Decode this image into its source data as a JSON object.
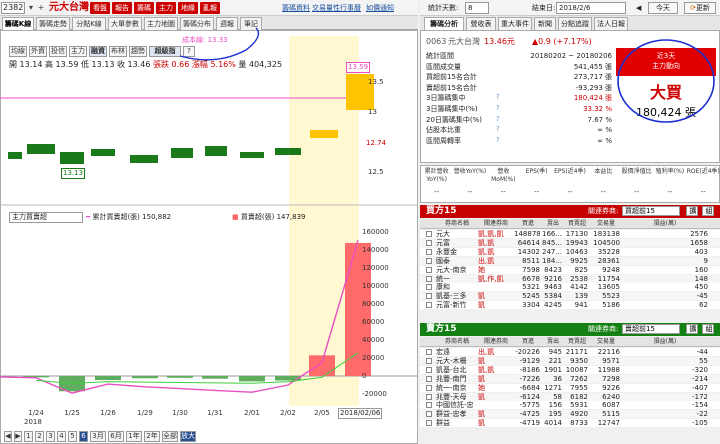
{
  "topbar": {
    "code": "2382R",
    "stock_name": "元大台灣",
    "buttons": [
      "看盤",
      "報告",
      "籌碼",
      "主力",
      "地緣",
      "亂報"
    ],
    "links": [
      "籌碼資料",
      "交易量性",
      "行事曆",
      "如價通知"
    ]
  },
  "left_tabs": [
    "籌碼K線",
    "籌碼走勢",
    "分點K線",
    "大單參數",
    "主力地圖",
    "籌碼分布",
    "週報",
    "筆記"
  ],
  "chart_tabs": [
    "均線",
    "外資",
    "投信",
    "主力",
    "融資",
    "布林",
    "趨勢",
    "超級指",
    "?"
  ],
  "cost_label": "成本線: 13.33",
  "ohlc": {
    "open_label": "開",
    "open": "13.14",
    "high_label": "高",
    "high": "13.59",
    "low_label": "低",
    "low": "13.13",
    "close_label": "收",
    "close": "13.46",
    "change": "張跌 0.66",
    "pct": "漲幅 5.16%",
    "vol_label": "量",
    "vol": "404,325"
  },
  "price_axis": [
    "13.59",
    "13.5",
    "13",
    "12.74",
    "12.5"
  ],
  "indicator": {
    "select": "主力買賣超",
    "legend1_label": "累計買賣超(張)",
    "legend1_value": "150,882",
    "legend2_label": "買賣超(張)",
    "legend2_value": "147,839"
  },
  "chart_data": [
    {
      "type": "bar",
      "title": "",
      "categories": [
        "1/24",
        "1/25",
        "1/26",
        "1/29",
        "1/30",
        "1/31",
        "2/01",
        "2/02",
        "2/05",
        "2/06"
      ],
      "series": [
        {
          "name": "買賣超(張)",
          "values": [
            -1500,
            -17000,
            -4500,
            -2500,
            -2000,
            -3000,
            -6000,
            -5000,
            23000,
            147839
          ]
        },
        {
          "name": "累計買賣超(張)",
          "values": [
            -2000,
            -19000,
            -9000,
            -12000,
            -14000,
            -16000,
            -18000,
            -10000,
            15000,
            150882
          ]
        }
      ],
      "ylim": [
        -20000,
        160000
      ],
      "yticks": [
        "160000",
        "140000",
        "120000",
        "100000",
        "80000",
        "60000",
        "40000",
        "20000",
        "0",
        "-20000"
      ]
    }
  ],
  "x_year": "2018",
  "x_highlight": "2018/02/06",
  "bottom_buttons": [
    "1",
    "2",
    "3",
    "4",
    "5",
    "6",
    "3月",
    "6月",
    "1年",
    "2年",
    "全部",
    "放大"
  ],
  "bottom_active": "6",
  "right_top": {
    "label": "統計天數:",
    "days": "8",
    "date_label": "結束日:",
    "date": "2018/2/6",
    "today": "今天",
    "refresh": "更新"
  },
  "right_tabs": [
    "籌碼分析",
    "營收表",
    "重大事件",
    "新聞",
    "分點追蹤",
    "法人日報"
  ],
  "info": {
    "code": "0063",
    "name": "元大台灣",
    "price": "13.46元",
    "change": "▲0.9 (+7.17%)",
    "rows": [
      {
        "label": "統計區間",
        "value": "20180202 ~ 20180206"
      },
      {
        "label": "區間成交量",
        "value": "541,455 張"
      },
      {
        "label": "買超前15名合計",
        "value": "273,717 張"
      },
      {
        "label": "賣超前15名合計",
        "value": "-93,293 張"
      },
      {
        "label": "3日籌碼集中",
        "value": "180,424 張"
      },
      {
        "label": "3日籌碼集中(%)",
        "value": "33.32 %"
      },
      {
        "label": "20日籌碼集中(%)",
        "value": "7.67 %"
      },
      {
        "label": "佔股本比重",
        "value": "∞ %"
      },
      {
        "label": "區間周轉率",
        "value": "∞ %"
      }
    ],
    "trend_label1": "近3天",
    "trend_label2": "主力動向",
    "trend_word": "大買",
    "trend_value": "180,424 張"
  },
  "metrics": {
    "headers": [
      "累計營收YoY(%)",
      "營收YoY(%)",
      "營收MoM(%)",
      "EPS(季)",
      "EPS(近4季)",
      "本益比",
      "股價淨值比",
      "殖利率(%)",
      "ROE(近4季)"
    ],
    "values": [
      "--",
      "--",
      "--",
      "--",
      "--",
      "--",
      "--",
      "--",
      "--"
    ]
  },
  "buy_table": {
    "title": "買方15",
    "select_label": "關連券商:",
    "select": "買超前15",
    "btn1": "擴",
    "btn2": "組",
    "headers": [
      "券商名稱",
      "關連券商",
      "買進",
      "賣出",
      "買賣超",
      "交易量",
      "損益(萬)"
    ],
    "rows": [
      [
        "元大",
        "凱,凱,凱",
        148878,
        "166...",
        17130,
        183138,
        2576
      ],
      [
        "元富",
        "凱,凱",
        64614,
        "845...",
        19943,
        104500,
        1658
      ],
      [
        "永豐金",
        "凱,凱",
        14302,
        "247...",
        10463,
        35228,
        403
      ],
      [
        "國泰",
        "出,凱",
        8511,
        "184...",
        9925,
        28361,
        9
      ],
      [
        "元大-南京",
        "她",
        7598,
        8423,
        825,
        9248,
        160
      ],
      [
        "統一",
        "凱,作,凱",
        6678,
        9216,
        2538,
        11754,
        148
      ],
      [
        "康和",
        "",
        5321,
        9463,
        4142,
        13605,
        450
      ],
      [
        "凱基-三多",
        "凱",
        5245,
        5384,
        139,
        5523,
        -45
      ],
      [
        "元富-新竹",
        "凱",
        3304,
        4245,
        941,
        5186,
        62
      ]
    ]
  },
  "sell_table": {
    "title": "賣方15",
    "select_label": "關連券商:",
    "select": "賣超前15",
    "btn1": "擴",
    "btn2": "組",
    "headers": [
      "券商名稱",
      "關連券商",
      "買進",
      "賣出",
      "買賣超",
      "交易量",
      "損益(萬)"
    ],
    "rows": [
      [
        "宏遠",
        "出,凱",
        -20226,
        945,
        21171,
        22116,
        -44
      ],
      [
        "元大-木柵",
        "凱",
        -9129,
        221,
        9350,
        9571,
        55
      ],
      [
        "凱基-台北",
        "凱,凱",
        -8186,
        1901,
        10087,
        11988,
        -320
      ],
      [
        "兆豐-南門",
        "凱",
        -7226,
        36,
        7262,
        7298,
        -214
      ],
      [
        "統一-南京",
        "她",
        -6684,
        1271,
        7955,
        9226,
        -407
      ],
      [
        "兆豐-天母",
        "凱",
        -6124,
        58,
        6182,
        6240,
        -172
      ],
      [
        "中國信託-忠孝",
        "",
        -5775,
        156,
        5931,
        6087,
        -154
      ],
      [
        "群益-忠孝",
        "凱",
        -4725,
        195,
        4920,
        5115,
        -22
      ],
      [
        "群益",
        "凱",
        -4719,
        4014,
        8733,
        12747,
        -105
      ]
    ]
  },
  "colors": {
    "up": "#e00000",
    "down": "#1a7a1a",
    "accent": "#c00000",
    "highlight": "#fff8d0",
    "pink": "#e94fc3"
  }
}
